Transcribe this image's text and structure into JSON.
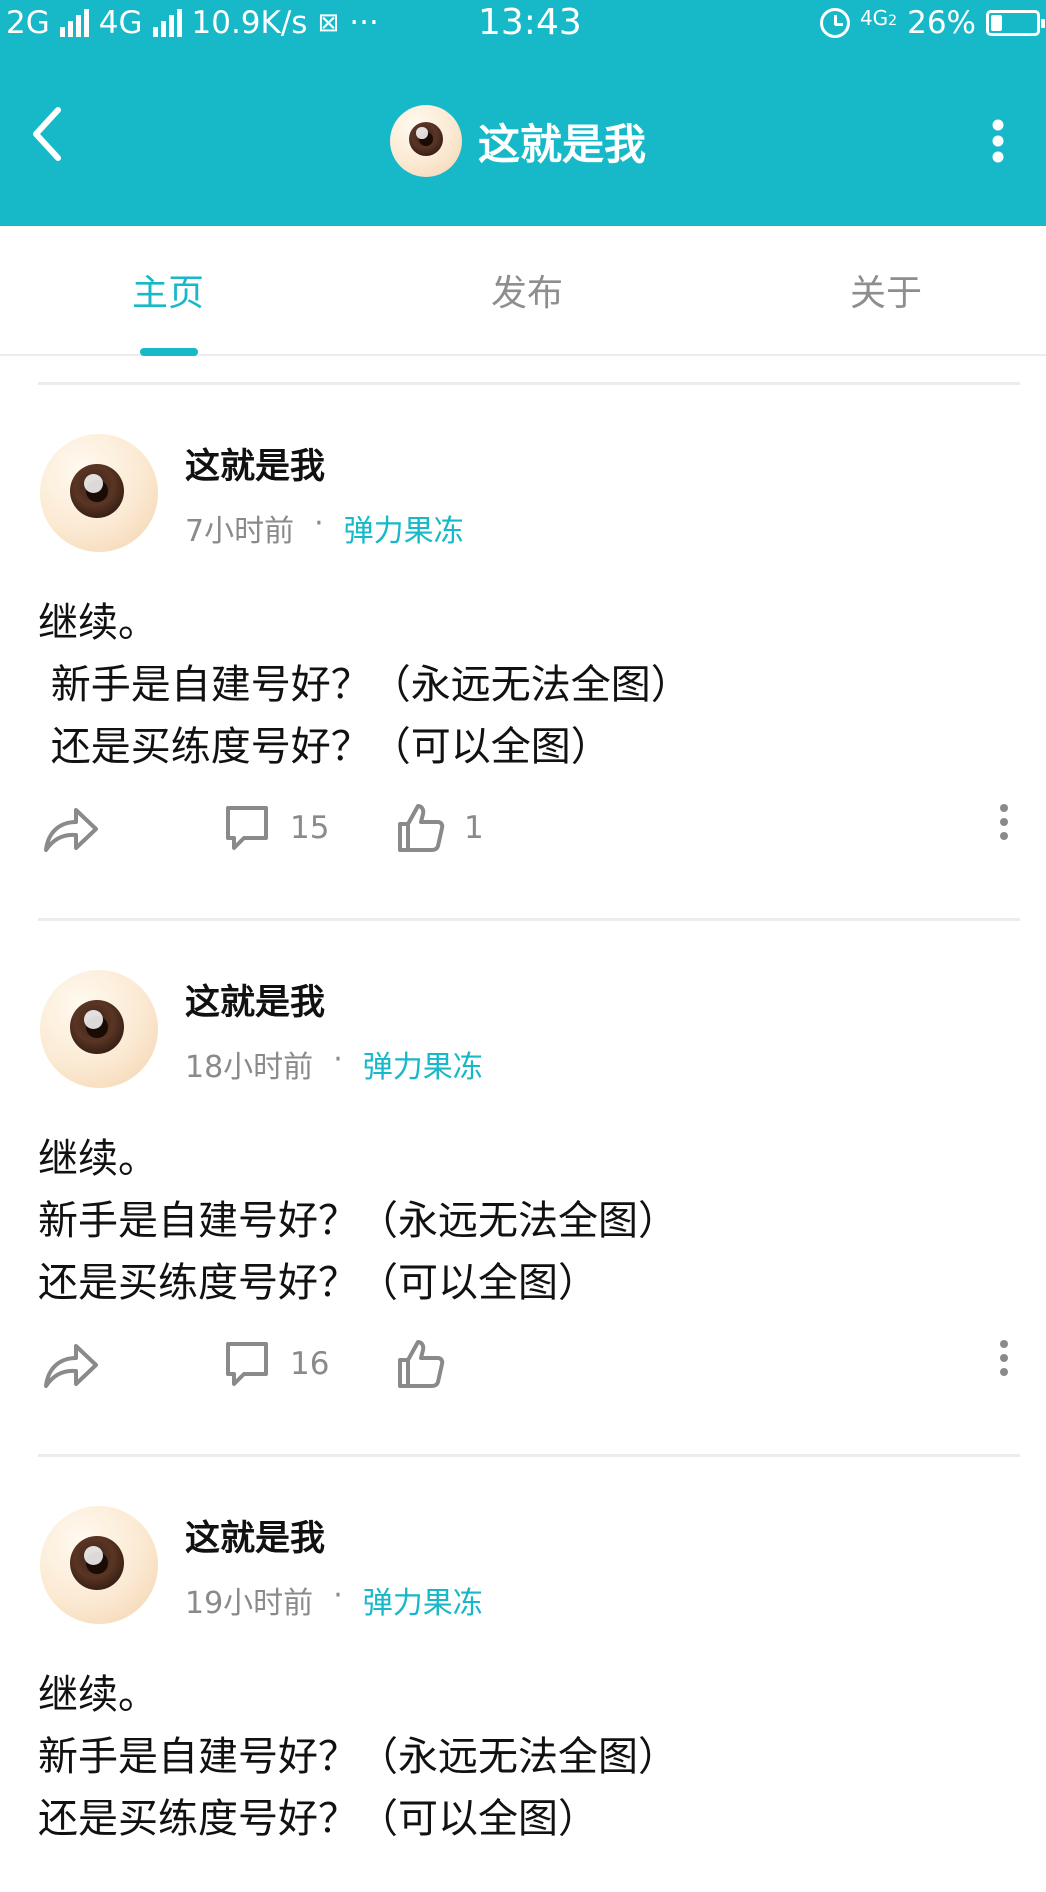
{
  "status_bar": {
    "net1": "2G",
    "net2": "4G",
    "speed": "10.9K/s",
    "dots": "···",
    "time": "13:43",
    "net3": "4G",
    "net3_sub": "2",
    "battery": "26%",
    "battery_level": 0.26
  },
  "app_bar": {
    "title": "这就是我",
    "back_icon": "chevron-left-icon",
    "more_icon": "more-vertical-icon"
  },
  "tabs": [
    {
      "label": "主页",
      "active": true
    },
    {
      "label": "发布",
      "active": false
    },
    {
      "label": "关于",
      "active": false
    }
  ],
  "posts": [
    {
      "author": "这就是我",
      "time": "7小时前",
      "separator": "·",
      "tag": "弹力果冻",
      "body": "继续。\n 新手是自建号好？（永远无法全图）\n 还是买练度号好？（可以全图）",
      "comments": "15",
      "likes": "1"
    },
    {
      "author": "这就是我",
      "time": "18小时前",
      "separator": "·",
      "tag": "弹力果冻",
      "body": "继续。\n新手是自建号好？（永远无法全图）\n还是买练度号好？（可以全图）",
      "comments": "16",
      "likes": ""
    },
    {
      "author": "这就是我",
      "time": "19小时前",
      "separator": "·",
      "tag": "弹力果冻",
      "body": "继续。\n新手是自建号好？（永远无法全图）\n还是买练度号好？（可以全图）"
    }
  ],
  "colors": {
    "accent": "#17b8c8",
    "muted": "#8a8a8a",
    "divider": "#ececec"
  }
}
